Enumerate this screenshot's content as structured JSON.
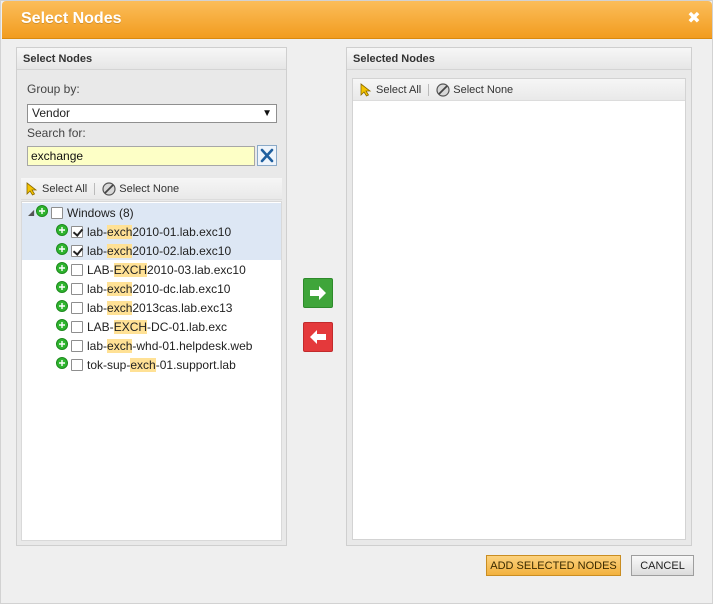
{
  "dialog": {
    "title": "Select Nodes"
  },
  "left_panel": {
    "header": "Select Nodes",
    "group_by_label": "Group by:",
    "group_by_value": "Vendor",
    "search_label": "Search for:",
    "search_value": "exchange",
    "toolbar": {
      "select_all": "Select All",
      "select_none": "Select None"
    },
    "group": {
      "label": "Windows (8)"
    },
    "nodes": [
      {
        "pre": "lab-",
        "match": "exch",
        "post": "2010-01.lab.exc10",
        "checked": true
      },
      {
        "pre": "lab-",
        "match": "exch",
        "post": "2010-02.lab.exc10",
        "checked": true
      },
      {
        "pre": "LAB-",
        "match": "EXCH",
        "post": "2010-03.lab.exc10",
        "checked": false
      },
      {
        "pre": "lab-",
        "match": "exch",
        "post": "2010-dc.lab.exc10",
        "checked": false
      },
      {
        "pre": "lab-",
        "match": "exch",
        "post": "2013cas.lab.exc13",
        "checked": false
      },
      {
        "pre": "LAB-",
        "match": "EXCH",
        "post": "-DC-01.lab.exc",
        "checked": false
      },
      {
        "pre": "lab-",
        "match": "exch",
        "post": "-whd-01.helpdesk.web",
        "checked": false
      },
      {
        "pre": "tok-sup-",
        "match": "exch",
        "post": "-01.support.lab",
        "checked": false
      }
    ]
  },
  "right_panel": {
    "header": "Selected Nodes",
    "toolbar": {
      "select_all": "Select All",
      "select_none": "Select None"
    }
  },
  "footer": {
    "add_label": "ADD SELECTED NODES",
    "cancel_label": "CANCEL"
  },
  "colors": {
    "title_bar": "#f29c1f",
    "search_highlight": "#ffe195",
    "selected_row": "#dde7f4",
    "add_arrow": "#3fa53a",
    "remove_arrow": "#e4393b",
    "status_up": "#2fb52f"
  }
}
